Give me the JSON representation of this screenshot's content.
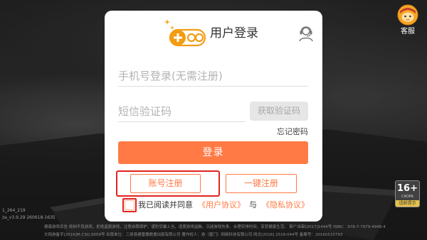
{
  "login_panel": {
    "title": "用户登录",
    "logo_icon": "gamepad-logo-icon",
    "support_icon": "headset-icon",
    "phone_field": {
      "value": "",
      "placeholder": "手机号登录(无需注册)"
    },
    "code_field": {
      "value": "",
      "placeholder": "短信验证码"
    },
    "get_code_label": "获取验证码",
    "forgot_password_label": "忘记密码",
    "login_label": "登录",
    "account_register_label": "账号注册",
    "quick_register_label": "一键注册",
    "agreement": {
      "checked": false,
      "prefix": "我已阅读并同意",
      "user_agreement_link": "《用户协议》",
      "conjunction": "与",
      "privacy_agreement_link": "《隐私协议》"
    }
  },
  "service_button": {
    "label": "客服",
    "icon": "customer-service-avatar-icon"
  },
  "age_rating": {
    "rating": "16+",
    "org": "CADPA",
    "note": "适龄提示"
  },
  "build_info": [
    "1_264_219",
    "za_v3.9.29 260618-1635"
  ],
  "footer_notice": [
    "健康游戏忠告 抵制不良游戏，拒绝盗版游戏，注意自我保护，谨防受骗上当，适度游戏益脑，沉迷游戏伤身，合理安排时间，享受健康生活。 新广出审[2017]1444号 ISBN： 978-7-7979-4948-4",
    "文网游备字[2016]M-CSG 0059号 出版单位：三原县建雷撒数据出版有限公司 著作权人：游（厦门）网络科技有限公司 网文[2016] 2518-044号 备案号：20160533793"
  ],
  "colors": {
    "accent": "#ff7a45",
    "highlight": "#e0231f",
    "card_background": "#ffffff",
    "disabled_button": "#e6e6e6",
    "logo": "#f39c12"
  }
}
